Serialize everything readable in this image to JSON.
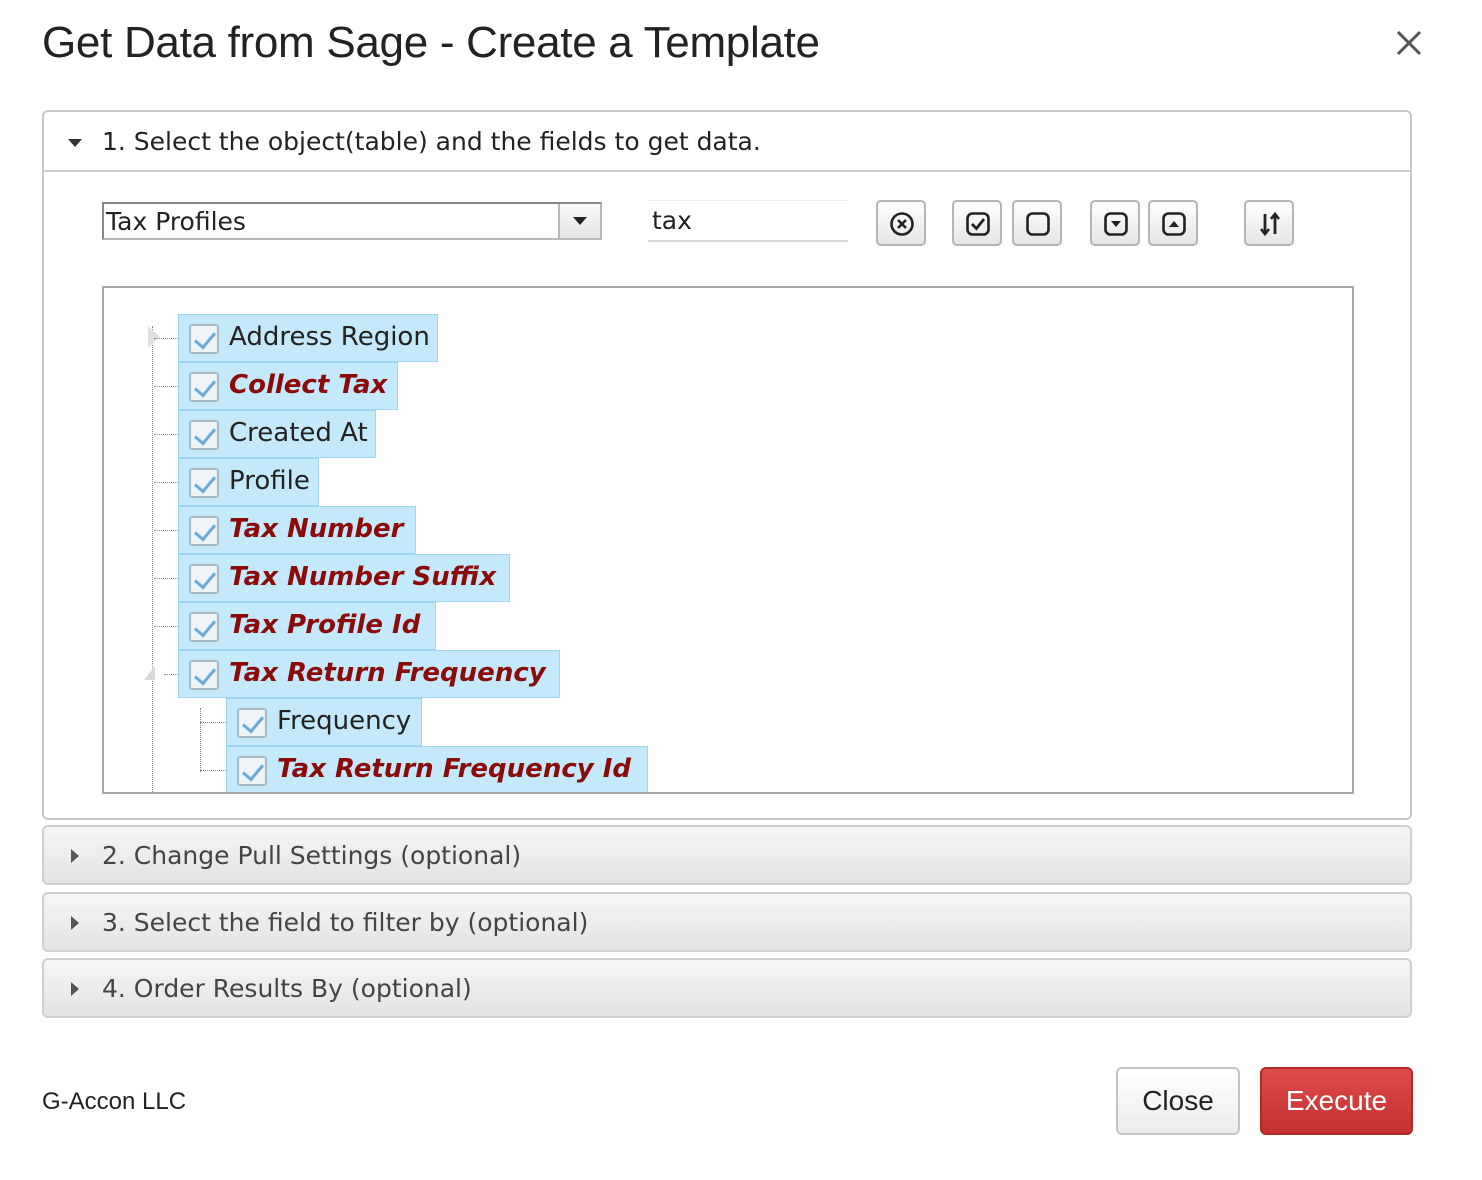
{
  "dialog": {
    "title": "Get Data from Sage - Create a Template"
  },
  "section1": {
    "label": "1. Select the object(table) and the fields to get data.",
    "object_select": {
      "value": "Tax Profiles"
    },
    "search": {
      "value": "tax",
      "placeholder": ""
    },
    "toolbar": {
      "icons": [
        "clear-search-icon",
        "check-all-icon",
        "uncheck-all-icon",
        "expand-all-icon",
        "collapse-all-icon",
        "sort-icon"
      ]
    },
    "tree": {
      "nodes": [
        {
          "label": "Address Region",
          "key": false,
          "checked": true
        },
        {
          "label": "Collect Tax",
          "key": true,
          "checked": true
        },
        {
          "label": "Created At",
          "key": false,
          "checked": true
        },
        {
          "label": "Profile",
          "key": false,
          "checked": true
        },
        {
          "label": "Tax Number",
          "key": true,
          "checked": true
        },
        {
          "label": "Tax Number Suffix",
          "key": true,
          "checked": true
        },
        {
          "label": "Tax Profile Id",
          "key": true,
          "checked": true
        },
        {
          "label": "Tax Return Frequency",
          "key": true,
          "checked": true
        },
        {
          "label": "Frequency",
          "key": false,
          "checked": true
        },
        {
          "label": "Tax Return Frequency Id",
          "key": true,
          "checked": true
        }
      ]
    }
  },
  "section2": {
    "label": "2. Change Pull Settings (optional)"
  },
  "section3": {
    "label": "3. Select the field to filter by (optional)"
  },
  "section4": {
    "label": "4. Order Results By (optional)"
  },
  "footer": {
    "company": "G-Accon LLC",
    "close_label": "Close",
    "execute_label": "Execute"
  },
  "colors": {
    "execute_button": "#c53030",
    "key_field_text": "#8b0a0a",
    "tree_node_bg": "#c3e9fb"
  }
}
